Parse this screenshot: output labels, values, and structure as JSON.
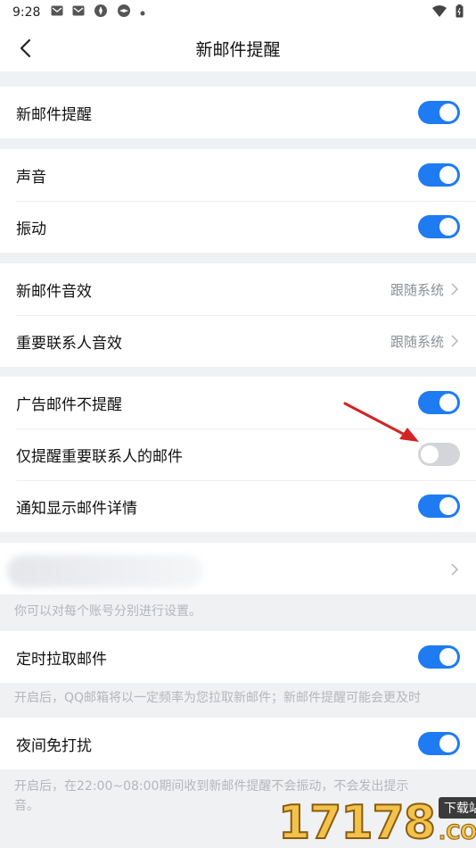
{
  "status_bar": {
    "time": "9:28",
    "left_icons": [
      "mail-icon",
      "mail-icon",
      "app-icon",
      "app-icon",
      "dot-icon"
    ],
    "right_icons": [
      "wifi-icon",
      "battery-icon"
    ]
  },
  "nav": {
    "title": "新邮件提醒",
    "back_icon": "back-arrow-icon"
  },
  "groups": {
    "g1": {
      "new_mail_alert": {
        "label": "新邮件提醒",
        "on": true
      }
    },
    "g2": {
      "sound": {
        "label": "声音",
        "on": true
      },
      "vibrate": {
        "label": "振动",
        "on": true
      }
    },
    "g3": {
      "new_mail_sound": {
        "label": "新邮件音效",
        "value": "跟随系统"
      },
      "vip_sound": {
        "label": "重要联系人音效",
        "value": "跟随系统"
      }
    },
    "g4": {
      "no_ad_alert": {
        "label": "广告邮件不提醒",
        "on": true
      },
      "vip_only": {
        "label": "仅提醒重要联系人的邮件",
        "on": false
      },
      "show_details": {
        "label": "通知显示邮件详情",
        "on": true
      }
    },
    "g5": {
      "account_note": "你可以对每个账号分别进行设置。"
    },
    "g6": {
      "scheduled_fetch": {
        "label": "定时拉取邮件",
        "on": true
      },
      "fetch_note": "开启后，QQ邮箱将以一定频率为您拉取新邮件；新邮件提醒可能会更及时"
    },
    "g7": {
      "dnd": {
        "label": "夜间免打扰",
        "on": true
      },
      "dnd_note": "开启后，在22:00~08:00期间收到新邮件提醒不会振动，不会发出提示音。"
    }
  },
  "watermark": {
    "digits": "17178",
    "badge": "下载站",
    "domain": ".COM"
  },
  "colors": {
    "accent": "#1f7bf2",
    "toggle_off": "#d3d5d8",
    "arrow": "#d32323"
  }
}
